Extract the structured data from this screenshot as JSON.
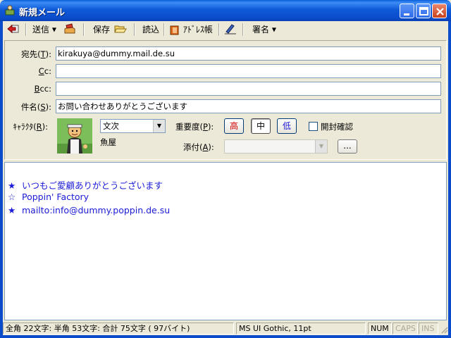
{
  "window": {
    "title": "新規メール"
  },
  "toolbar": {
    "send_label": "送信",
    "save_label": "保存",
    "load_label": "読込",
    "address_label": "ｱﾄﾞﾚｽ帳",
    "signature_label": "署名"
  },
  "header": {
    "to": {
      "label_pre": "宛先(",
      "label_key": "T",
      "label_post": "):",
      "value": "kirakuya@dummy.mail.de.su"
    },
    "cc": {
      "label_key": "C",
      "label_post": "c:",
      "value": ""
    },
    "bcc": {
      "label_key": "B",
      "label_post": "cc:",
      "value": ""
    },
    "subject": {
      "label_pre": "件名(",
      "label_key": "S",
      "label_post": "):",
      "value": "お問い合わせありがとうございます"
    },
    "character": {
      "label_pre": "ｷｬﾗｸﾀ(",
      "label_key": "R",
      "label_post": "):",
      "selected": "文次",
      "caption": "魚屋"
    },
    "priority": {
      "label_pre": "重要度(",
      "label_key": "P",
      "label_post": "):",
      "high": "高",
      "medium": "中",
      "low": "低",
      "selected": "中",
      "high_color": "#d00000",
      "low_color": "#1a1ad8"
    },
    "read_receipt": {
      "label": "開封確認",
      "checked": false
    },
    "attach": {
      "label_pre": "添付(",
      "label_key": "A",
      "label_post": "):",
      "value": "",
      "browse_label": "..."
    }
  },
  "body": {
    "lines": [
      {
        "star": "★",
        "text": "いつもご愛顧ありがとうございます"
      },
      {
        "star": "☆",
        "text": "Poppin' Factory"
      },
      {
        "star": "★",
        "text": "mailto:info@dummy.poppin.de.su"
      }
    ],
    "text_color": "#1a1ad8"
  },
  "status": {
    "counts": "全角 22文字: 半角 53文字: 合計 75文字 ( 97バイト)",
    "font": "MS UI Gothic, 11pt",
    "num": "NUM",
    "caps": "CAPS",
    "ins": "INS"
  },
  "colors": {
    "titlebar": "#0a4ccb",
    "face": "#ece9d8"
  }
}
